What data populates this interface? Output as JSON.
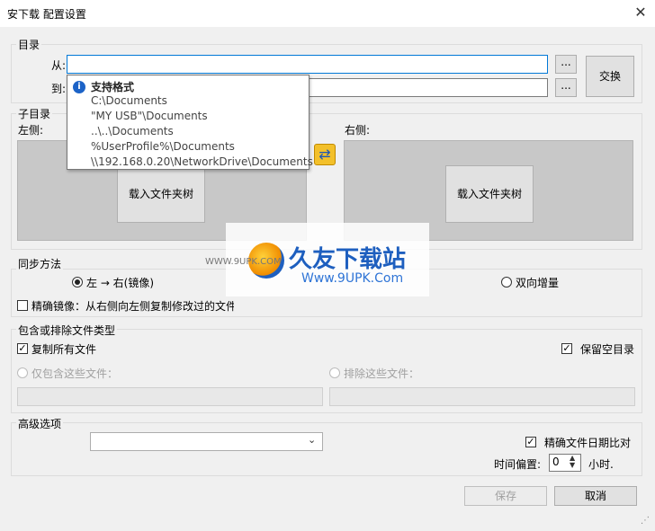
{
  "window": {
    "title": "安下载 配置设置",
    "close_glyph": "✕"
  },
  "directory": {
    "label": "目录",
    "from_label": "从:",
    "to_label": "到:",
    "from_value": "",
    "to_value": "",
    "browse_label": "...",
    "swap_label": "交换"
  },
  "tooltip": {
    "title": "支持格式",
    "icon": "info-icon",
    "lines": [
      "C:\\Documents",
      "\"MY USB\"\\Documents",
      "..\\..\\Documents",
      "%UserProfile%\\Documents",
      "\\\\192.168.0.20\\NetworkDrive\\Documents"
    ]
  },
  "subdir": {
    "label": "子目录",
    "left_label": "左侧:",
    "right_label": "右侧:",
    "load_label": "载入文件夹树",
    "swap_icon": "swap-arrows-icon"
  },
  "sync": {
    "label": "同步方法",
    "left_to_right": "左 → 右(镜像)",
    "two_way": "双向增量",
    "exact_mirror": "精确镜像：从右侧向左侧复制修改过的文件",
    "selected": "left_to_right"
  },
  "filters": {
    "label": "包含或排除文件类型",
    "copy_all": "复制所有文件",
    "keep_empty": "保留空目录",
    "include_only": "仅包含这些文件：",
    "exclude": "排除这些文件：",
    "copy_all_checked": true,
    "keep_empty_checked": true
  },
  "advanced": {
    "label": "高级选项",
    "dropdown_value": "",
    "exact_date": "精确文件日期比对",
    "exact_date_checked": true,
    "offset_label": "时间偏置:",
    "offset_value": "0",
    "offset_unit": "小时."
  },
  "footer": {
    "save": "保存",
    "cancel": "取消"
  },
  "watermark": {
    "brand": "久友下载站",
    "url": "Www.9UPK.Com",
    "small_url": "WWW.9UPK.COM"
  },
  "colors": {
    "focus": "#0078d7",
    "info": "#1c63c7",
    "swap_icon": "#f3c02a"
  }
}
